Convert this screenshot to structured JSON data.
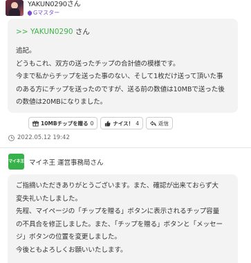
{
  "comment": {
    "user": {
      "name": "YAKUN0290さん",
      "rank": "Gマスター"
    },
    "mention_prefix": ">> ",
    "mention_name": "YAKUN0290",
    "mention_suffix": " さん",
    "lines": [
      "追記。",
      "どうもこれ、双方の送ったチップの合計値の模様です。",
      "今まで私からチップを送った事のない、そして1枚だけ送って頂いた事",
      "のある方にチップを送ったのですが、送る前の数値は10MBで送った後",
      "の数値は20MBになりました。"
    ],
    "actions": {
      "tip_label": "10MBチップを贈る",
      "tip_count": "0",
      "nice_label": "ナイス！",
      "nice_count": "4",
      "reply_label": "返信"
    },
    "timestamp": "2022.05.12 19:42"
  },
  "reply": {
    "user": {
      "logo_text": "マイネ王",
      "name": "マイネ王 運営事務局さん"
    },
    "lines": [
      "ご指摘いただきありがとうございます。また、確認が出来ておらず大",
      "変失礼いたしました。",
      "先程、マイページの「チップを贈る」ボタンに表示されるチップ容量",
      "の不具合を修正しました。また、「チップを贈る」ボタンと「メッセー",
      "ジ」ボタンの位置を変更しました。",
      "今後ともよろしくお願いいたします。"
    ]
  },
  "colors": {
    "accent_green": "#3fb349",
    "rank_purple": "#7a4fd1",
    "bubble_bg": "#f3f3f3"
  }
}
